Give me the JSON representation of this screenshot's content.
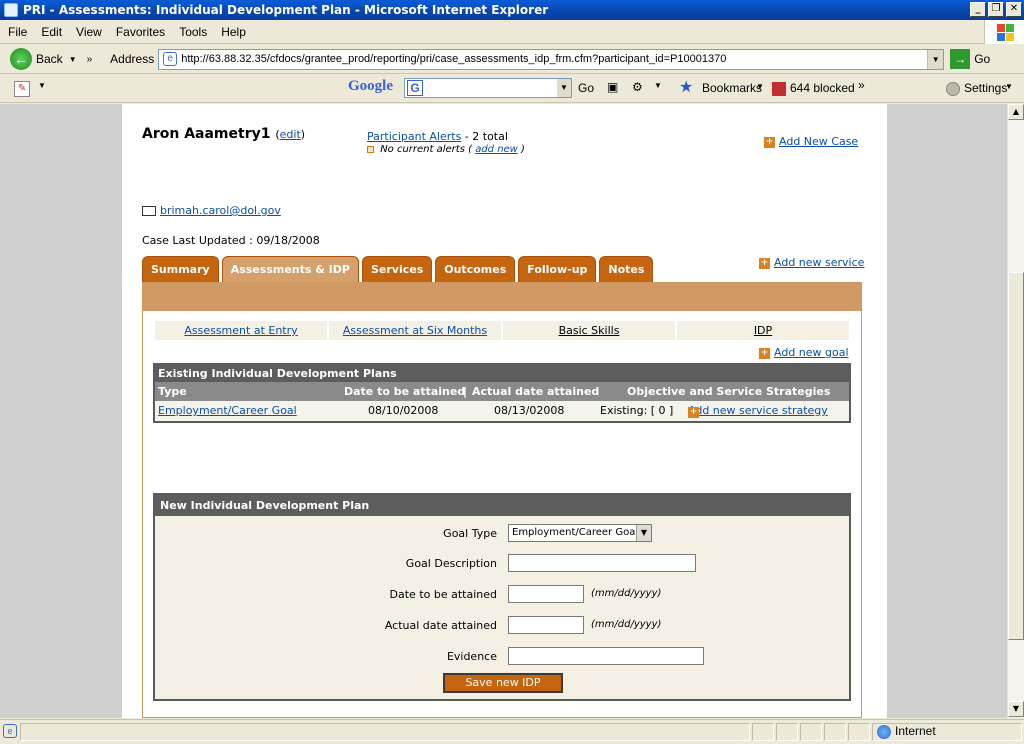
{
  "window": {
    "title": "PRI - Assessments: Individual Development Plan - Microsoft Internet Explorer",
    "controls": [
      "_",
      "❐",
      "✕"
    ]
  },
  "menu": [
    "File",
    "Edit",
    "View",
    "Favorites",
    "Tools",
    "Help"
  ],
  "toolbar": {
    "back_label": "Back",
    "address_label": "Address",
    "url": "http://63.88.32.35/cfdocs/grantee_prod/reporting/pri/case_assessments_idp_frm.cfm?participant_id=P10001370",
    "go_label": "Go"
  },
  "google_bar": {
    "logo": "Google",
    "go_label": "Go",
    "bookmarks_label": "Bookmarks",
    "blocked_label": "644 blocked",
    "settings_label": "Settings"
  },
  "participant": {
    "name": "Aron Aaametry1",
    "edit_open": "(",
    "edit_label": "edit",
    "edit_close": ")",
    "alerts_link": "Participant Alerts",
    "alerts_total": "- 2 total",
    "no_alerts": "No current alerts (",
    "add_new_alert": "add new",
    "no_alerts_close": ")",
    "add_new_case": "Add New Case",
    "email": "brimah.carol@dol.gov",
    "updated": "Case Last Updated : 09/18/2008",
    "add_new_service": "Add new service"
  },
  "tabs": [
    {
      "label": "Summary",
      "active": false
    },
    {
      "label": "Assessments & IDP",
      "active": true
    },
    {
      "label": "Services",
      "active": false
    },
    {
      "label": "Outcomes",
      "active": false
    },
    {
      "label": "Follow-up",
      "active": false
    },
    {
      "label": "Notes",
      "active": false
    }
  ],
  "subtabs": [
    "Assessment at Entry",
    "Assessment at Six Months",
    "Basic Skills",
    "IDP"
  ],
  "add_new_goal": "Add new goal",
  "existing": {
    "title": "Existing Individual Development Plans",
    "headers": [
      "Type",
      "Date to be attained",
      "|",
      "Actual date attained",
      "Objective and Service Strategies"
    ],
    "row": {
      "type": "Employment/Career Goal",
      "date_to_attain": "08/10/02008",
      "actual_date": "08/13/02008",
      "existing": "Existing: [ 0 ]",
      "add_strategy": "Add new service strategy"
    }
  },
  "new_idp": {
    "title": "New Individual Development Plan",
    "goal_type_label": "Goal Type",
    "goal_type_value": "Employment/Career Goal",
    "goal_desc_label": "Goal Description",
    "date_attain_label": "Date to be attained",
    "actual_date_label": "Actual date attained",
    "date_hint": "(mm/dd/yyyy)",
    "evidence_label": "Evidence",
    "save_label": "Save new IDP"
  },
  "status": {
    "zone": "Internet"
  }
}
